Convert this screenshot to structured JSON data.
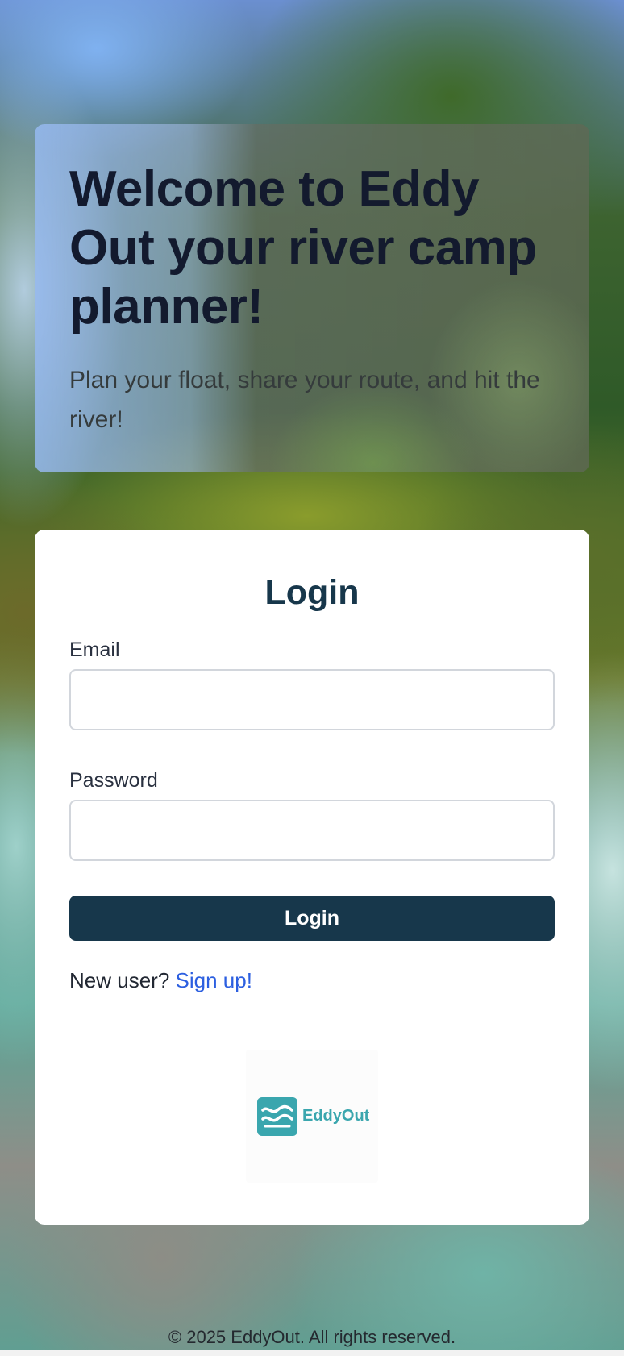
{
  "hero": {
    "title": "Welcome to Eddy Out your river camp planner!",
    "subtitle": "Plan your float, share your route, and hit the river!"
  },
  "login": {
    "heading": "Login",
    "email_label": "Email",
    "email_value": "",
    "password_label": "Password",
    "password_value": "",
    "submit_label": "Login",
    "new_user_text": "New user?",
    "signup_link": "Sign up!"
  },
  "logo": {
    "text": "EddyOut",
    "icon": "waves-icon",
    "color": "#3aa6ae"
  },
  "footer": {
    "text": "© 2025 EddyOut. All rights reserved."
  },
  "colors": {
    "primary": "#17374b",
    "link": "#2c5fe0"
  }
}
